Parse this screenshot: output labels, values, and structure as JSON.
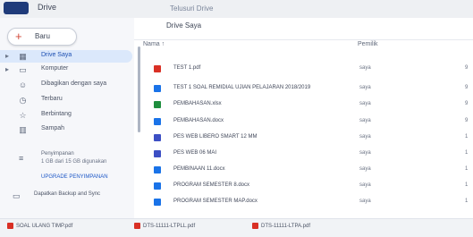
{
  "header": {
    "app_title": "Drive",
    "search_text": "Telusuri Drive"
  },
  "sidebar": {
    "new_button_label": "Baru",
    "items": [
      {
        "label": "Drive Saya",
        "icon": "drive-icon",
        "active": true
      },
      {
        "label": "Komputer",
        "icon": "computer-icon"
      },
      {
        "label": "Dibagikan dengan saya",
        "icon": "people-icon"
      },
      {
        "label": "Terbaru",
        "icon": "clock-icon"
      },
      {
        "label": "Berbintang",
        "icon": "star-icon"
      },
      {
        "label": "Sampah",
        "icon": "trash-icon"
      }
    ],
    "storage": {
      "title": "Penyimpanan",
      "used": "1 GB dari 15 GB digunakan",
      "upgrade": "UPGRADE PENYIMPANAN"
    },
    "backup": "Dapatkan Backup and Sync"
  },
  "main": {
    "breadcrumb": "Drive Saya",
    "name_header": "Nama ↑",
    "owner_header": "Pemilik",
    "files": [
      {
        "name": "TEST 1.pdf",
        "owner": "saya",
        "modified": "9",
        "icon_color": "#d93025"
      },
      {
        "name": "TEST 1 SOAL REMIDIAL UJIAN PELAJARAN 2018/2019",
        "owner": "saya",
        "modified": "9",
        "icon_color": "#1a73e8"
      },
      {
        "name": "PEMBAHASAN.xlsx",
        "owner": "saya",
        "modified": "9",
        "icon_color": "#1e8e3e"
      },
      {
        "name": "PEMBAHASAN.docx",
        "owner": "saya",
        "modified": "9",
        "icon_color": "#1a73e8"
      },
      {
        "name": "PES WEB LIBERO SMART 12 MM",
        "owner": "saya",
        "modified": "1",
        "icon_color": "#3c4fc4"
      },
      {
        "name": "PES WEB 06 MAI",
        "owner": "saya",
        "modified": "1",
        "icon_color": "#3c4fc4"
      },
      {
        "name": "PEMBINAAN 11.docx",
        "owner": "saya",
        "modified": "1",
        "icon_color": "#1a73e8"
      },
      {
        "name": "PROGRAM SEMESTER 8.docx",
        "owner": "saya",
        "modified": "1",
        "icon_color": "#1a73e8"
      },
      {
        "name": "PROGRAM SEMESTER MAP.docx",
        "owner": "saya",
        "modified": "1",
        "icon_color": "#1a73e8"
      }
    ]
  },
  "downloads": [
    {
      "name": "SOAL ULANG TIMP.pdf",
      "icon_color": "#d93025"
    },
    {
      "name": "DTS-11111-LTPLL.pdf",
      "icon_color": "#d93025"
    },
    {
      "name": "DTS-11111-LTPA.pdf",
      "icon_color": "#d93025"
    }
  ]
}
